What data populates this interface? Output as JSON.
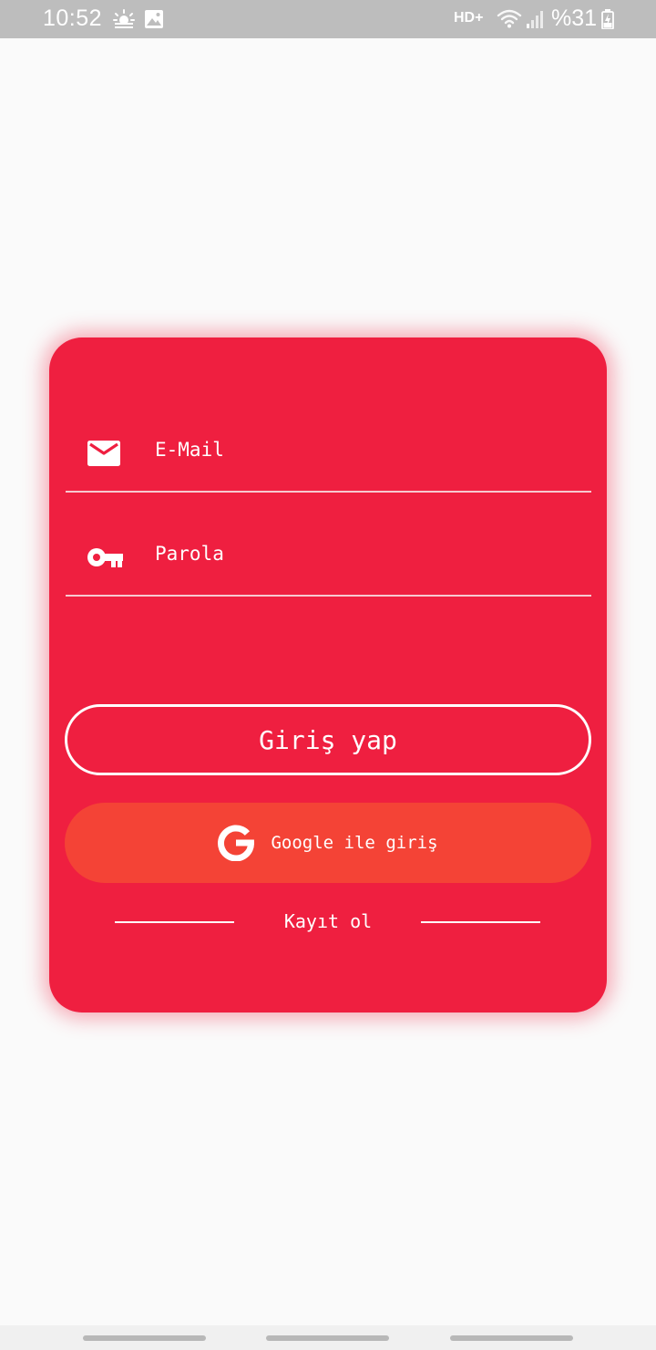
{
  "status_bar": {
    "time": "10:52",
    "network": "HD+",
    "battery": "%31",
    "icons": [
      "weather-icon",
      "gallery-icon",
      "wifi-icon",
      "signal-icon",
      "battery-icon"
    ]
  },
  "login_card": {
    "email": {
      "placeholder": "E-Mail",
      "value": "",
      "icon": "mail-icon"
    },
    "password": {
      "placeholder": "Parola",
      "value": "",
      "icon": "key-icon"
    },
    "login_button_label": "Giriş yap",
    "google_button_label": "Google ile giriş",
    "signup_label": "Kayıt ol"
  },
  "colors": {
    "card_background": "#ef1f40",
    "google_button": "#f44336",
    "page_background": "#fafafa",
    "status_bar": "#bdbdbd",
    "text": "#ffffff"
  }
}
